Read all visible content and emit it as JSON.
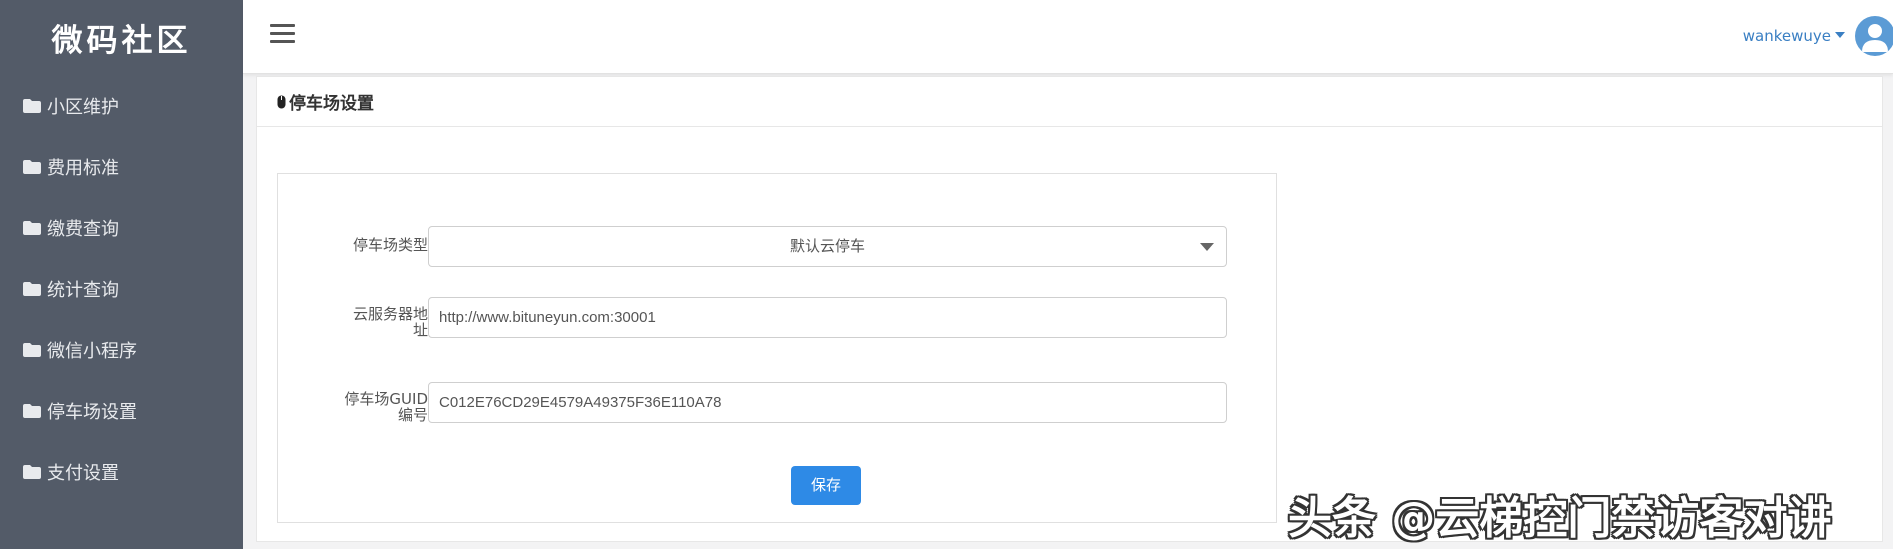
{
  "brand": {
    "title": "微码社区"
  },
  "sidebar": {
    "items": [
      {
        "label": "小区维护",
        "icon": "folder-icon"
      },
      {
        "label": "费用标准",
        "icon": "folder-icon"
      },
      {
        "label": "缴费查询",
        "icon": "folder-icon"
      },
      {
        "label": "统计查询",
        "icon": "folder-icon"
      },
      {
        "label": "微信小程序",
        "icon": "folder-icon"
      },
      {
        "label": "停车场设置",
        "icon": "folder-icon"
      },
      {
        "label": "支付设置",
        "icon": "folder-icon"
      }
    ]
  },
  "header": {
    "menu_icon": "hamburger-menu-icon",
    "user_name": "wankewuye",
    "avatar_icon": "user-avatar-icon"
  },
  "panel": {
    "title": "停车场设置",
    "title_icon": "mouse-icon"
  },
  "form": {
    "type_label": "停车场类型",
    "type_value": "默认云停车",
    "server_label_line1": "云服务器地",
    "server_label_line2": "址",
    "server_value": "http://www.bituneyun.com:30001",
    "guid_label_line1": "停车场GUID",
    "guid_label_line2": "编号",
    "guid_value": "C012E76CD29E4579A49375F36E110A78",
    "save_label": "保存"
  },
  "watermark": {
    "text": "头条 @云梯控门禁访客对讲"
  },
  "colors": {
    "sidebar_bg": "#535b68",
    "accent": "#2e8ae6",
    "user_link": "#3a7fc3"
  }
}
